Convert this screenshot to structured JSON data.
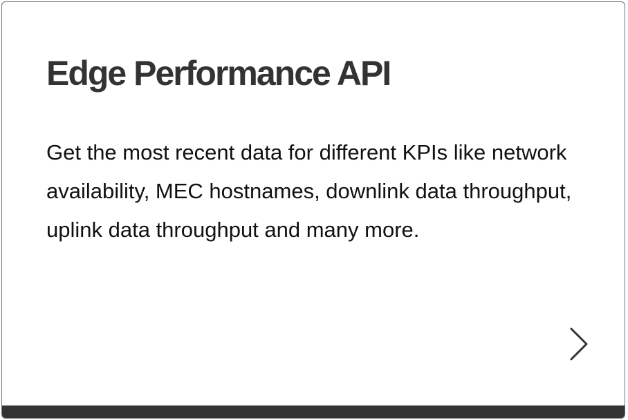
{
  "card": {
    "title": "Edge Performance API",
    "description": "Get the most recent data for different KPIs like network availability, MEC hostnames, downlink data throughput, uplink data throughput and many more.",
    "action_icon": "chevron-right-icon",
    "colors": {
      "border": "#6f6f6f",
      "title": "#333333",
      "text": "#111111",
      "bottom_bar": "#333333",
      "background": "#ffffff"
    }
  }
}
